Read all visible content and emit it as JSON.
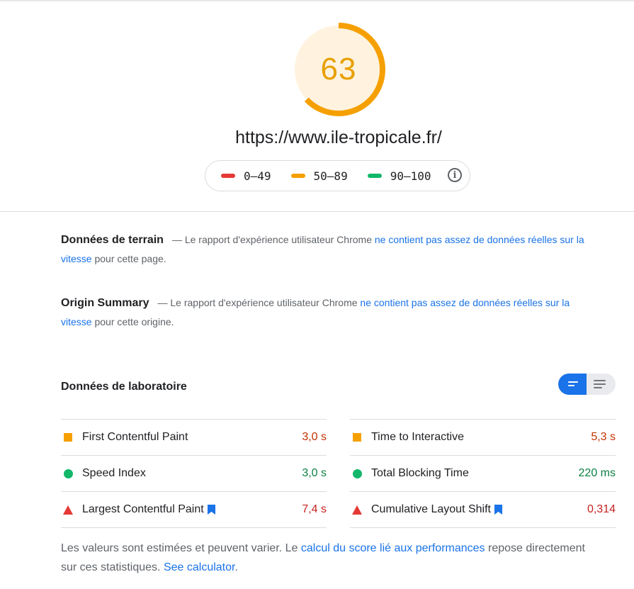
{
  "colors": {
    "fail": "#e53935",
    "average": "#f5a000",
    "pass": "#12b76a",
    "link": "#1a73e8",
    "value_fail": "#c5221f",
    "value_average": "#c33300",
    "value_pass": "#0d8043"
  },
  "score": {
    "value": "63",
    "fraction": 0.63
  },
  "url": "https://www.ile-tropicale.fr/",
  "legend": {
    "items": [
      {
        "range": "0–49",
        "color": "#e53935"
      },
      {
        "range": "50–89",
        "color": "#f5a000"
      },
      {
        "range": "90–100",
        "color": "#12b76a"
      }
    ],
    "info_icon": "info-icon"
  },
  "field_data": {
    "title": "Données de terrain",
    "dash": "—",
    "text_before": "Le rapport d'expérience utilisateur Chrome",
    "link": "ne contient pas assez de données réelles sur la vitesse",
    "text_after": "pour cette page."
  },
  "origin_summary": {
    "title": "Origin Summary",
    "dash": "—",
    "text_before": "Le rapport d'expérience utilisateur Chrome",
    "link": "ne contient pas assez de données réelles sur la vitesse",
    "text_after": "pour cette origine."
  },
  "lab_data": {
    "title": "Données de laboratoire",
    "view_toggle": {
      "selected": "summary-view",
      "icons": [
        "summary-view-icon",
        "list-view-icon"
      ]
    },
    "metrics_left": [
      {
        "name": "First Contentful Paint",
        "value": "3,0 s",
        "rating": "average",
        "bookmark": false
      },
      {
        "name": "Speed Index",
        "value": "3,0 s",
        "rating": "pass",
        "bookmark": false
      },
      {
        "name": "Largest Contentful Paint",
        "value": "7,4 s",
        "rating": "fail",
        "bookmark": true
      }
    ],
    "metrics_right": [
      {
        "name": "Time to Interactive",
        "value": "5,3 s",
        "rating": "average",
        "bookmark": false
      },
      {
        "name": "Total Blocking Time",
        "value": "220 ms",
        "rating": "pass",
        "bookmark": false
      },
      {
        "name": "Cumulative Layout Shift",
        "value": "0,314",
        "rating": "fail",
        "bookmark": true
      }
    ]
  },
  "footer": {
    "text1": "Les valeurs sont estimées et peuvent varier. Le",
    "link1": "calcul du score lié aux performances",
    "text2": "repose directement sur ces statistiques.",
    "link2": "See calculator",
    "text3": "."
  }
}
